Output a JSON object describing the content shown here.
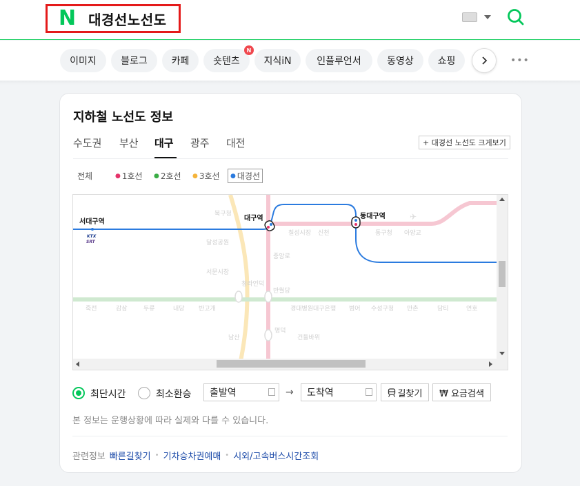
{
  "header": {
    "logo": "N",
    "query": "대경선노선도"
  },
  "tabs": [
    {
      "label": "이미지"
    },
    {
      "label": "블로그"
    },
    {
      "label": "카페"
    },
    {
      "label": "숏텐츠",
      "badge": "N"
    },
    {
      "label": "지식iN"
    },
    {
      "label": "인플루언서"
    },
    {
      "label": "동영상"
    },
    {
      "label": "쇼핑"
    }
  ],
  "card": {
    "title": "지하철 노선도 정보",
    "cities": [
      "수도권",
      "부산",
      "대구",
      "광주",
      "대전"
    ],
    "active_city": "대구",
    "enlarge_label": "+ 대경선 노선도 크게보기",
    "line_filters": [
      {
        "label": "전체",
        "color": ""
      },
      {
        "label": "1호선",
        "color": "#e5336a"
      },
      {
        "label": "2호선",
        "color": "#3aad45"
      },
      {
        "label": "3호선",
        "color": "#f5b43b"
      },
      {
        "label": "대경선",
        "color": "#2b7bdf"
      }
    ]
  },
  "map": {
    "stations": {
      "seodaegu": "서대구역",
      "daegu": "대구역",
      "dongdaegu": "동대구역"
    },
    "faded_labels": [
      "북구청",
      "달성공원",
      "서문시장",
      "청라언덕",
      "반월당",
      "중앙로",
      "대구역",
      "칠성시장",
      "신천",
      "동구청",
      "아양교",
      "죽전",
      "감삼",
      "두류",
      "내당",
      "반고개",
      "경대병원",
      "대구은행",
      "범어",
      "수성구청",
      "만촌",
      "담티",
      "연호",
      "남산",
      "명덕",
      "건들바위"
    ],
    "ktx_label": "KTX",
    "srt_label": "SRT"
  },
  "route": {
    "option_fastest": "최단시간",
    "option_min_transfer": "최소환승",
    "from_placeholder": "출발역",
    "to_placeholder": "도착역",
    "arrow": "→",
    "find_button": "길찾기",
    "fare_button": "₩ 요금검색"
  },
  "notice": "본 정보는 운행상황에 따라 실제와 다를 수 있습니다.",
  "related": {
    "label": "관련정보",
    "links": [
      "빠른길찾기",
      "기차승차권예매",
      "시외/고속버스시간조회"
    ]
  }
}
